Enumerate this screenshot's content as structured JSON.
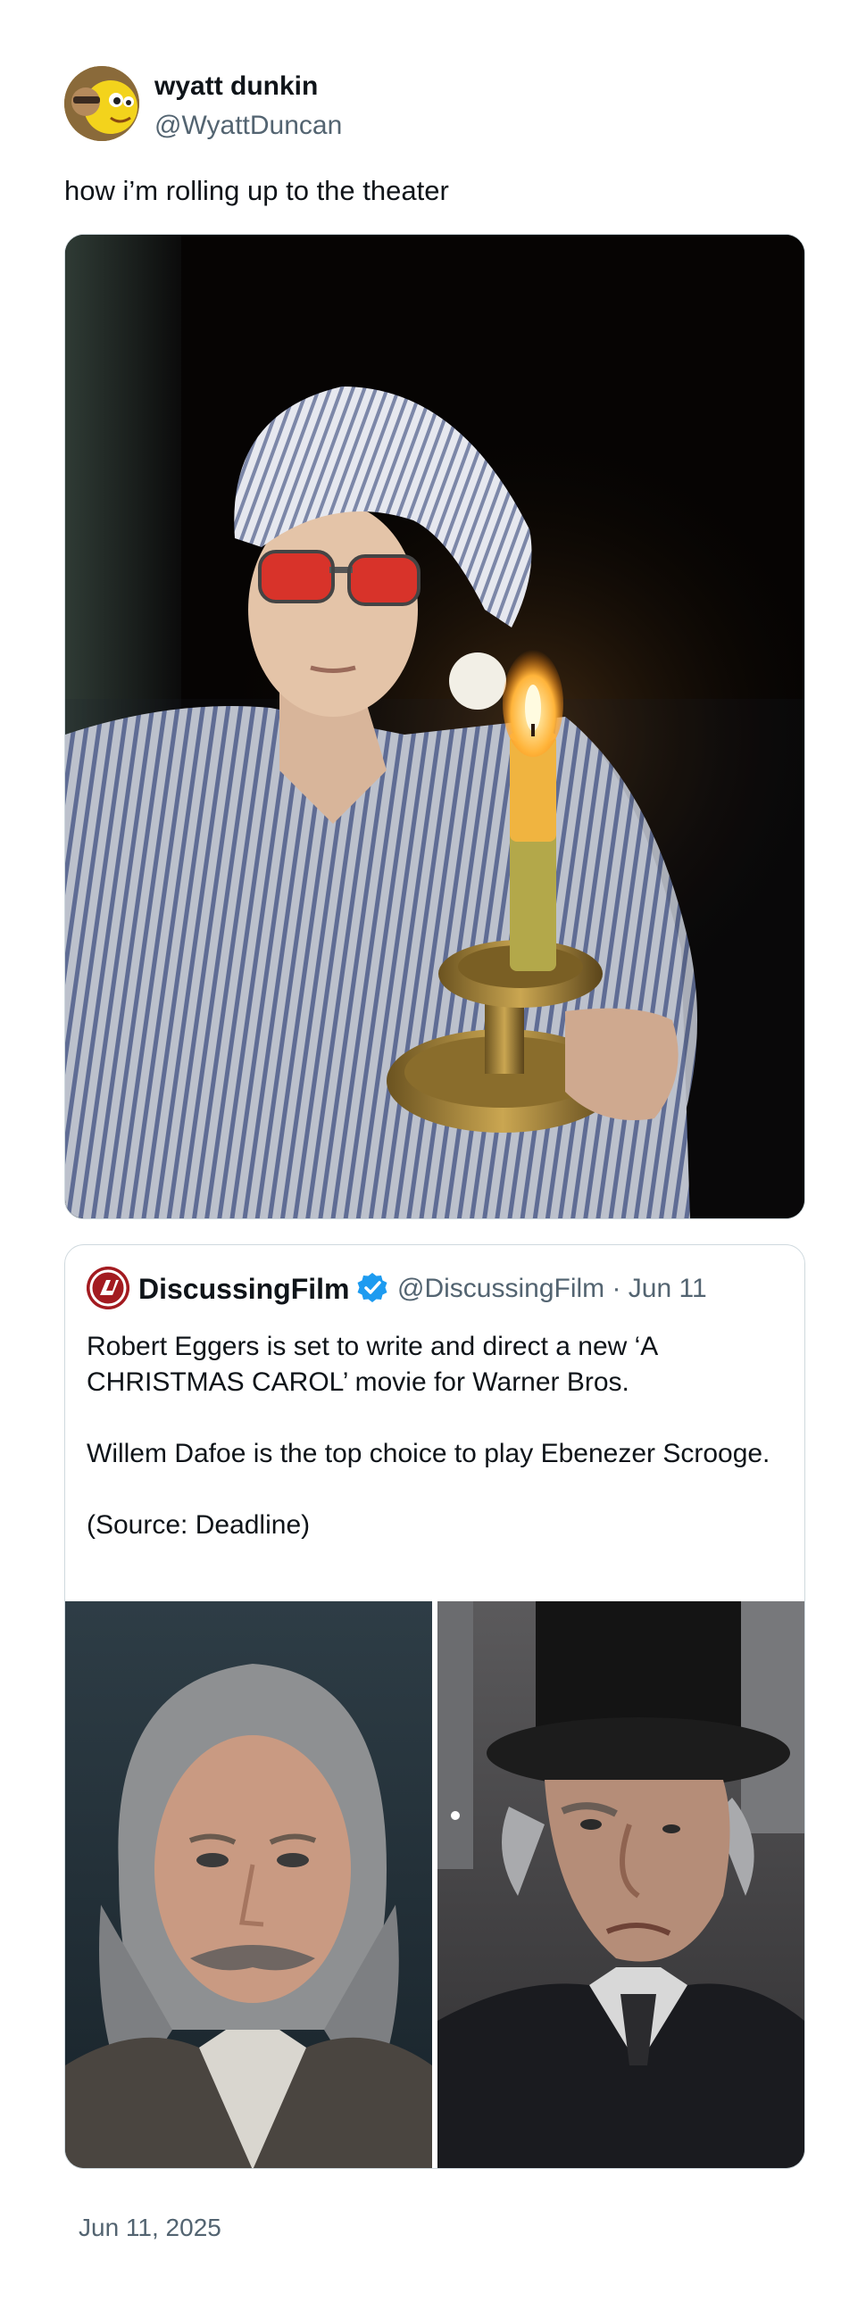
{
  "tweet": {
    "author_name": "wyatt dunkin",
    "author_handle": "@WyattDuncan",
    "text": "how i’m rolling up to the theater",
    "date": "Jun 11, 2025"
  },
  "quoted_tweet": {
    "author_name": "DiscussingFilm",
    "author_handle_and_date": "@DiscussingFilm · Jun 11",
    "verified": true,
    "paragraphs": [
      "Robert Eggers is set to write and direct a new ‘A CHRISTMAS CAROL’ movie for Warner Bros.",
      "Willem Dafoe is the top choice to play Ebenezer Scrooge.",
      "(Source: Deadline)"
    ]
  },
  "icons": {
    "verified": "verified-badge-icon",
    "logo": "discussingfilm-logo"
  },
  "colors": {
    "text": "#0f1419",
    "secondary": "#536471",
    "border": "#cfd9de",
    "verified_blue": "#1d9bf0",
    "logo_red": "#a31b20"
  }
}
